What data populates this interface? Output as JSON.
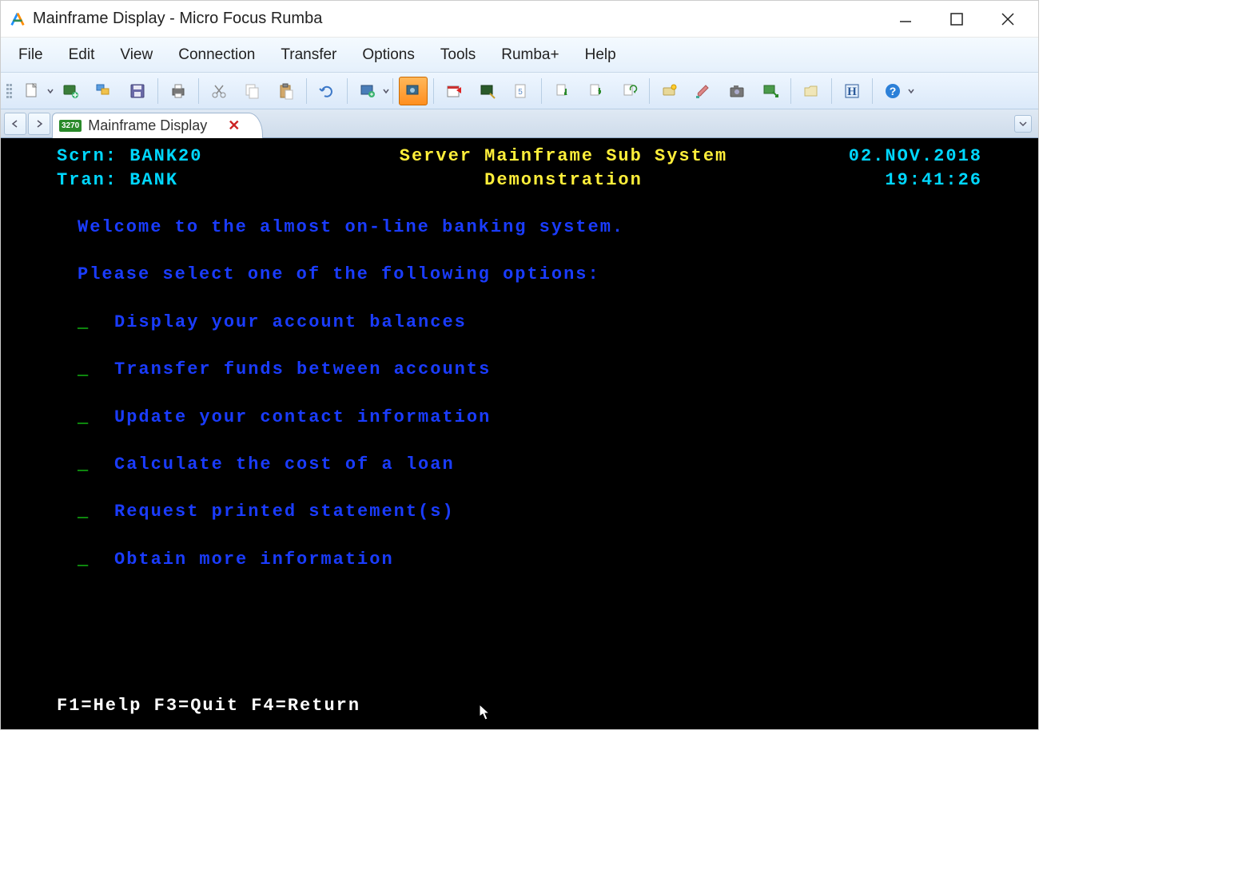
{
  "window": {
    "title": "Mainframe Display - Micro Focus Rumba"
  },
  "menu": {
    "items": [
      "File",
      "Edit",
      "View",
      "Connection",
      "Transfer",
      "Options",
      "Tools",
      "Rumba+",
      "Help"
    ]
  },
  "toolbar_icons": [
    "new-document",
    "connect",
    "sessions",
    "save",
    "print",
    "cut",
    "copy",
    "paste",
    "undo",
    "screen-capture",
    "macro-record",
    "calendar-flag",
    "screen-area",
    "page-num",
    "transfer-download",
    "transfer-upload",
    "transfer-refresh",
    "key-mapping",
    "color-brush",
    "camera-snapshot",
    "screen-export",
    "document-open",
    "history",
    "help"
  ],
  "tab": {
    "badge": "3270",
    "label": "Mainframe Display"
  },
  "screen": {
    "scrn_label": "Scrn:",
    "scrn_value": "BANK20",
    "tran_label": "Tran:",
    "tran_value": "BANK",
    "title_line1": "Server Mainframe Sub System",
    "title_line2": "Demonstration",
    "date": "02.NOV.2018",
    "time": "19:41:26",
    "welcome": "Welcome to the almost on-line banking system.",
    "prompt": "Please select one of the following options:",
    "options": [
      "Display your account balances",
      "Transfer funds between accounts",
      "Update your contact information",
      "Calculate the cost of a loan",
      "Request printed statement(s)",
      "Obtain more information"
    ],
    "fkeys": "F1=Help F3=Quit F4=Return"
  }
}
